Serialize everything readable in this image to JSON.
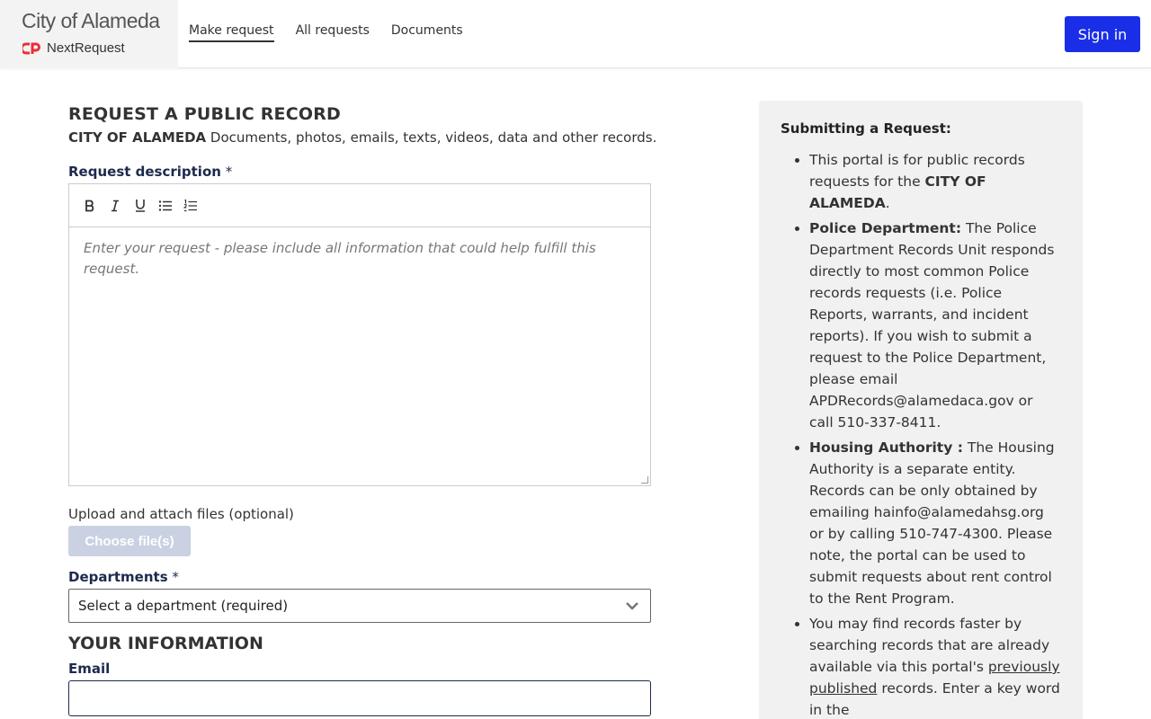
{
  "header": {
    "city_name": "City of Alameda",
    "product_name": "NextRequest",
    "nav": [
      {
        "label": "Make request",
        "active": true
      },
      {
        "label": "All requests",
        "active": false
      },
      {
        "label": "Documents",
        "active": false
      }
    ],
    "signin_label": "Sign in",
    "accent_color": "#1a2ee8",
    "logo_color": "#e8303a"
  },
  "form": {
    "title": "REQUEST A PUBLIC RECORD",
    "subtitle_strong": "CITY OF ALAMEDA",
    "subtitle_rest": " Documents, photos, emails, texts, videos, data and other records.",
    "description_label": "Request description",
    "required_mark": " *",
    "toolbar_icons": [
      "bold-icon",
      "italic-icon",
      "underline-icon",
      "bullet-list-icon",
      "numbered-list-icon"
    ],
    "description_placeholder": "Enter your request - please include all information that could help fulfill this request.",
    "upload_label": "Upload and attach files (optional)",
    "choose_files_label": "Choose file(s)",
    "departments_label": "Departments",
    "departments_selected": "Select a department (required)",
    "your_info_title": "YOUR INFORMATION",
    "email_label": "Email",
    "email_value": ""
  },
  "sidebar": {
    "title": "Submitting a Request:",
    "item1_pre": "This portal is for public records requests for the ",
    "item1_strong": "CITY OF ALAMEDA",
    "item1_post": ".",
    "item2_strong": "Police Department:",
    "item2_text": " The Police Department Records Unit responds directly to most common Police records requests (i.e. Police Reports, warrants, and incident reports). If you wish to submit a request to the Police Department, please email APDRecords@alamedaca.gov or call 510-337-8411.",
    "item3_strong": "Housing Authority :",
    "item3_text": " The Housing Authority is a separate entity. Records can be only obtained by emailing hainfo@alamedahsg.org or by calling 510-747-4300. Please note, the portal can be used to submit requests about rent control to the Rent Program.",
    "item4_pre": "You may find records faster by searching records that are already available via this portal's ",
    "item4_link": "previously published",
    "item4_post": " records. Enter a key word in the"
  }
}
